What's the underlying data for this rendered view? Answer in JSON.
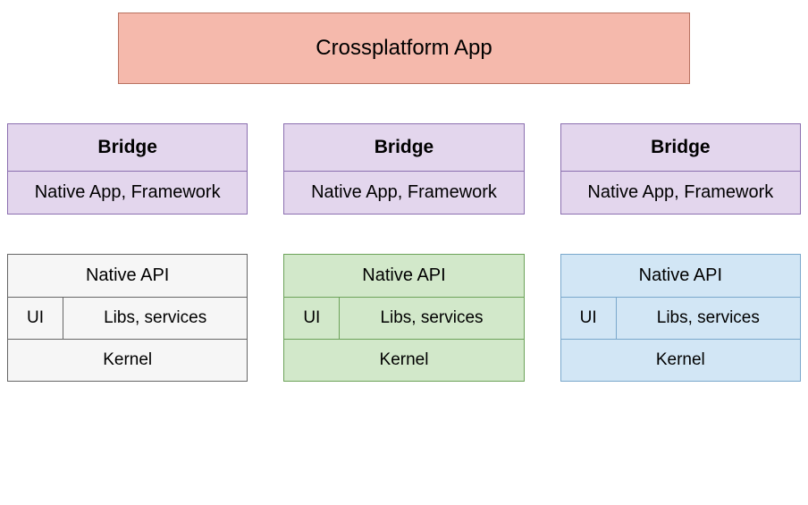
{
  "top": {
    "label": "Crossplatform App"
  },
  "bridges": [
    {
      "header": "Bridge",
      "sub": "Native App, Framework"
    },
    {
      "header": "Bridge",
      "sub": "Native App, Framework"
    },
    {
      "header": "Bridge",
      "sub": "Native App, Framework"
    }
  ],
  "os": [
    {
      "api": "Native API",
      "ui": "UI",
      "libs": "Libs, services",
      "kernel": "Kernel"
    },
    {
      "api": "Native API",
      "ui": "UI",
      "libs": "Libs, services",
      "kernel": "Kernel"
    },
    {
      "api": "Native API",
      "ui": "UI",
      "libs": "Libs, services",
      "kernel": "Kernel"
    }
  ]
}
